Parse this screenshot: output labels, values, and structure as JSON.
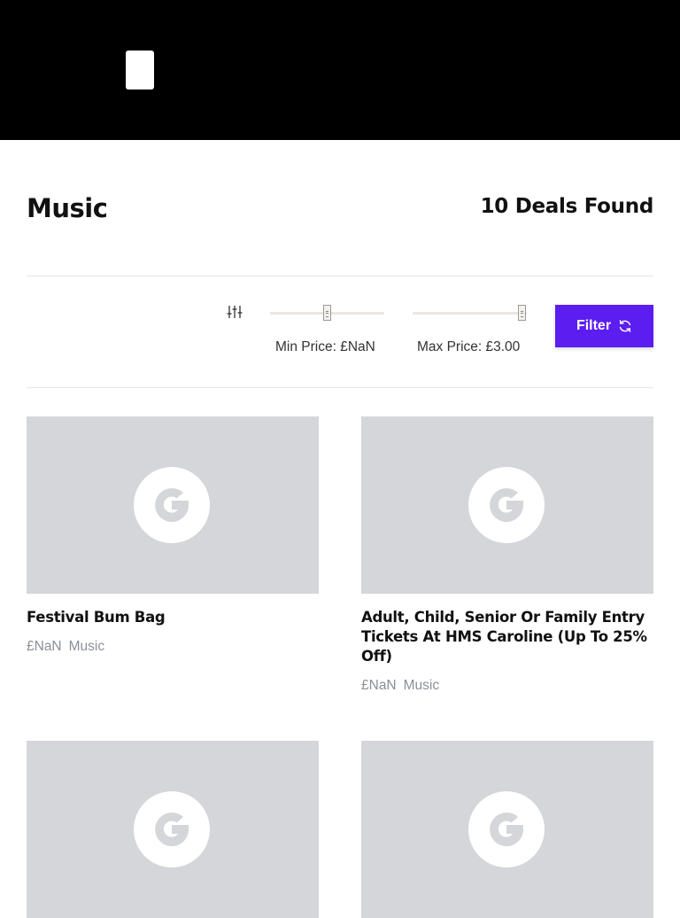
{
  "page": {
    "title": "Music",
    "deals_found": "10 Deals Found"
  },
  "filters": {
    "min_price_label": "Min Price: £NaN",
    "max_price_label": "Max Price: £3.00",
    "filter_button_label": "Filter",
    "icons": {
      "filter": "sliders-icon",
      "refresh": "refresh-icon"
    }
  },
  "deals": [
    {
      "title": "Festival Bum Bag",
      "price": "£NaN",
      "category": "Music"
    },
    {
      "title": "Adult, Child, Senior Or Family Entry Tickets At HMS Caroline (Up To 25% Off)",
      "price": "£NaN",
      "category": "Music"
    },
    {
      "title": "",
      "price": "",
      "category": ""
    },
    {
      "title": "",
      "price": "",
      "category": ""
    }
  ],
  "colors": {
    "header_bg": "#000000",
    "accent": "#5b1df0",
    "placeholder_bg": "#d4d6d9",
    "muted_text": "#8a8f98"
  }
}
